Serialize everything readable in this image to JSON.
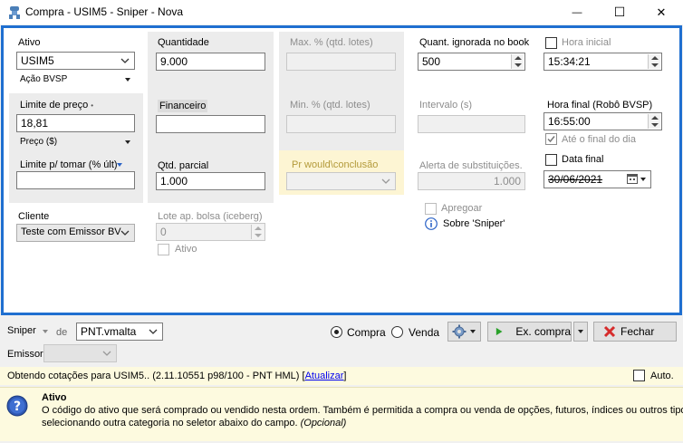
{
  "window": {
    "title": "Compra - USIM5 - Sniper - Nova",
    "minimize_glyph": "—",
    "maximize_glyph": "☐",
    "close_glyph": "✕"
  },
  "form": {
    "ativo": {
      "label": "Ativo",
      "value": "USIM5",
      "type_option": "Ação BVSP"
    },
    "limite_preco": {
      "label": "Limite de preço",
      "marker": "•",
      "value": "18,81",
      "unit_option": "Preço ($)"
    },
    "limite_tomar": {
      "label": "Limite p/ tomar (% últ)",
      "value": ""
    },
    "cliente": {
      "label": "Cliente",
      "value": "Teste com Emissor BV"
    },
    "quantidade": {
      "label": "Quantidade",
      "value": "9.000"
    },
    "financeiro": {
      "label": "Financeiro",
      "value": ""
    },
    "qtd_parcial": {
      "label": "Qtd. parcial",
      "value": "1.000"
    },
    "lote_ap_bolsa": {
      "label": "Lote ap. bolsa (iceberg)",
      "value": "0",
      "ativo_label": "Ativo"
    },
    "max_pct": {
      "label": "Max. % (qtd. lotes)",
      "value": ""
    },
    "min_pct": {
      "label": "Min. % (qtd. lotes)",
      "value": ""
    },
    "pr_would": {
      "label": "Pr would\\conclusão",
      "value": ""
    },
    "quant_ignorada": {
      "label": "Quant. ignorada no book",
      "value": "500"
    },
    "intervalo": {
      "label": "Intervalo (s)",
      "value": ""
    },
    "alerta_subst": {
      "label": "Alerta de substituições.",
      "value": "1.000"
    },
    "apregoar": {
      "label": "Apregoar"
    },
    "sobre": {
      "label": "Sobre 'Sniper'"
    },
    "hora_inicial": {
      "label": "Hora inicial",
      "value": "15:34:21",
      "checked": false
    },
    "hora_final": {
      "label": "Hora final (Robô BVSP)",
      "value": "16:55:00"
    },
    "ate_final_dia": {
      "label": "Até o final do dia",
      "checked": true
    },
    "data_final": {
      "label": "Data final",
      "value": "30/06/2021",
      "checked": false
    }
  },
  "bottom": {
    "sniper_label": "Sniper",
    "de_label": "de",
    "strategy_value": "PNT.vmalta",
    "emissor_label": "Emissor",
    "emissor_value": "",
    "compra_label": "Compra",
    "venda_label": "Venda",
    "ex_compra_label": "Ex. compra",
    "fechar_label": "Fechar"
  },
  "status": {
    "text": "Obtendo cotações para USIM5..  (2.11.10551 p98/100 - PNT HML)",
    "link_label": "Atualizar",
    "auto_label": "Auto."
  },
  "help": {
    "title": "Ativo",
    "body_line1": "O código do ativo que será comprado ou vendido nesta ordem. Também é permitida a compra ou venda de opções, futuros, índices ou outros tipos",
    "body_line2": "selecionando outra categoria no seletor abaixo do campo.",
    "optional": "(Opcional)"
  },
  "colors": {
    "accent_border": "#1f6fd0",
    "help_bg": "#fdfadf",
    "link": "#0000ee",
    "go_green": "#2aa12a",
    "close_red": "#d62b2b"
  }
}
